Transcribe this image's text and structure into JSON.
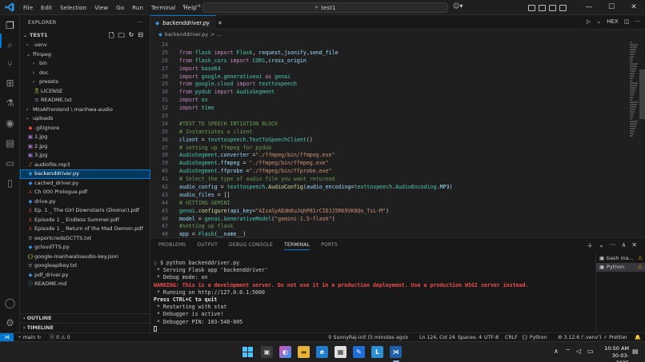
{
  "menu": [
    "File",
    "Edit",
    "Selection",
    "View",
    "Go",
    "Run",
    "Terminal",
    "Help"
  ],
  "search": {
    "text": "test1"
  },
  "sidebar": {
    "header": "EXPLORER",
    "folder": "TEST1",
    "items": [
      {
        "label": ".venv",
        "depth": 1,
        "type": "folder",
        "open": false,
        "color": "#cccccc"
      },
      {
        "label": "ffmpeg",
        "depth": 1,
        "type": "folder",
        "open": true,
        "color": "#cccccc"
      },
      {
        "label": "bin",
        "depth": 2,
        "type": "folder",
        "open": false,
        "color": "#cccccc"
      },
      {
        "label": "doc",
        "depth": 2,
        "type": "folder",
        "open": false,
        "color": "#cccccc"
      },
      {
        "label": "presets",
        "depth": 2,
        "type": "folder",
        "open": false,
        "color": "#cccccc"
      },
      {
        "label": "LICENSE",
        "depth": 2,
        "type": "license",
        "color": "#cccccc"
      },
      {
        "label": "README.txt",
        "depth": 2,
        "type": "txt",
        "color": "#cccccc"
      },
      {
        "label": "MtoAFrontend \\ manhwa-audio",
        "depth": 1,
        "type": "folder",
        "open": false,
        "color": "#cccccc"
      },
      {
        "label": "uploads",
        "depth": 1,
        "type": "folder",
        "open": false,
        "color": "#cccccc"
      },
      {
        "label": ".gitignore",
        "depth": 1,
        "type": "git",
        "color": "#cccccc"
      },
      {
        "label": "1.jpg",
        "depth": 1,
        "type": "img",
        "color": "#cccccc"
      },
      {
        "label": "2.jpg",
        "depth": 1,
        "type": "img",
        "color": "#cccccc"
      },
      {
        "label": "3.jpg",
        "depth": 1,
        "type": "img",
        "color": "#cccccc"
      },
      {
        "label": "audiofile.mp3",
        "depth": 1,
        "type": "audio",
        "color": "#cccccc"
      },
      {
        "label": "backenddriver.py",
        "depth": 1,
        "type": "py",
        "color": "#ffffff",
        "selected": true
      },
      {
        "label": "cached_driver.py",
        "depth": 1,
        "type": "py",
        "color": "#cccccc"
      },
      {
        "label": "Ch 000 Prologue.pdf",
        "depth": 1,
        "type": "pdf",
        "color": "#cccccc"
      },
      {
        "label": "drive.py",
        "depth": 1,
        "type": "py",
        "color": "#cccccc"
      },
      {
        "label": "Ep. 1 _ The Girl Downstairs (Doona!).pdf",
        "depth": 1,
        "type": "pdf",
        "color": "#cccccc"
      },
      {
        "label": "Episode 1 _ Endless Summer.pdf",
        "depth": 1,
        "type": "pdf",
        "color": "#cccccc"
      },
      {
        "label": "Episode 1 _ Return of the Mad Demon.pdf",
        "depth": 1,
        "type": "pdf",
        "color": "#cccccc"
      },
      {
        "label": "exportcredsGCTTS.txt",
        "depth": 1,
        "type": "txt",
        "color": "#cccccc"
      },
      {
        "label": "gcloudTTS.py",
        "depth": 1,
        "type": "py",
        "color": "#cccccc"
      },
      {
        "label": "google-manhwatoaudio-key.json",
        "depth": 1,
        "type": "json",
        "color": "#cccccc"
      },
      {
        "label": "googleapikey.txt",
        "depth": 1,
        "type": "txt",
        "color": "#cccccc"
      },
      {
        "label": "pdf_driver.py",
        "depth": 1,
        "type": "py",
        "color": "#cccccc"
      },
      {
        "label": "README.md",
        "depth": 1,
        "type": "md",
        "color": "#cccccc"
      }
    ],
    "outline": "OUTLINE",
    "timeline": "TIMELINE"
  },
  "editor": {
    "tab": "backenddriver.py",
    "breadcrumb_file": "backenddriver.py",
    "breadcrumb_rest": "> ...",
    "lines": [
      {
        "n": "24",
        "t": []
      },
      {
        "n": "25",
        "t": [
          [
            "kw",
            "from "
          ],
          [
            "cls",
            "flask "
          ],
          [
            "kw",
            "import "
          ],
          [
            "cls",
            "Flask"
          ],
          [
            "txt",
            ", "
          ],
          [
            "id",
            "request"
          ],
          [
            "txt",
            ","
          ],
          [
            "id",
            "jsonify"
          ],
          [
            "txt",
            ","
          ],
          [
            "id",
            "send_file"
          ]
        ]
      },
      {
        "n": "26",
        "t": [
          [
            "kw",
            "from "
          ],
          [
            "cls",
            "flask_cors "
          ],
          [
            "kw",
            "import "
          ],
          [
            "cls",
            "CORS"
          ],
          [
            "txt",
            ","
          ],
          [
            "id",
            "cross_origin"
          ]
        ]
      },
      {
        "n": "27",
        "t": [
          [
            "kw",
            "import "
          ],
          [
            "cls",
            "base64"
          ]
        ]
      },
      {
        "n": "28",
        "t": [
          [
            "kw",
            "import "
          ],
          [
            "cls",
            "google.generativeai "
          ],
          [
            "kw",
            "as "
          ],
          [
            "cls",
            "genai"
          ]
        ]
      },
      {
        "n": "29",
        "t": [
          [
            "kw",
            "from "
          ],
          [
            "cls",
            "google.cloud "
          ],
          [
            "kw",
            "import "
          ],
          [
            "cls",
            "texttospeech"
          ]
        ]
      },
      {
        "n": "30",
        "t": [
          [
            "kw",
            "from "
          ],
          [
            "cls",
            "pydub "
          ],
          [
            "kw",
            "import "
          ],
          [
            "cls",
            "AudioSegment"
          ]
        ]
      },
      {
        "n": "31",
        "t": [
          [
            "kw",
            "import "
          ],
          [
            "cls",
            "os"
          ]
        ]
      },
      {
        "n": "32",
        "t": [
          [
            "kw",
            "import "
          ],
          [
            "cls",
            "time"
          ]
        ]
      },
      {
        "n": "33",
        "t": []
      },
      {
        "n": "34",
        "t": [
          [
            "cmt",
            "#TEXT TO SPEECH INTIATION BLOCK"
          ]
        ]
      },
      {
        "n": "35",
        "t": [
          [
            "cmt",
            "# Instantiates a client"
          ]
        ]
      },
      {
        "n": "36",
        "t": [
          [
            "id",
            "client "
          ],
          [
            "txt",
            "= "
          ],
          [
            "cls",
            "texttospeech"
          ],
          [
            "txt",
            "."
          ],
          [
            "cls",
            "TextToSpeechClient"
          ],
          [
            "txt",
            "()"
          ]
        ]
      },
      {
        "n": "37",
        "t": [
          [
            "cmt",
            "# setting up ffmpeg for pydub"
          ]
        ]
      },
      {
        "n": "38",
        "t": [
          [
            "cls",
            "AudioSegment"
          ],
          [
            "txt",
            "."
          ],
          [
            "id",
            "converter "
          ],
          [
            "txt",
            "="
          ],
          [
            "str",
            "\"./ffmpeg/bin/ffmpeg.exe\""
          ]
        ]
      },
      {
        "n": "39",
        "t": [
          [
            "cls",
            "AudioSegment"
          ],
          [
            "txt",
            "."
          ],
          [
            "id",
            "ffmpeg "
          ],
          [
            "txt",
            "= "
          ],
          [
            "str",
            "\"./ffmpeg/bin/ffmpeg.exe\""
          ]
        ]
      },
      {
        "n": "40",
        "t": [
          [
            "cls",
            "AudioSegment"
          ],
          [
            "txt",
            "."
          ],
          [
            "id",
            "ffprobe "
          ],
          [
            "txt",
            "="
          ],
          [
            "str",
            "\"./ffmpeg/bin/ffprobe.exe\""
          ]
        ]
      },
      {
        "n": "41",
        "t": [
          [
            "cmt",
            "# Select the type of audio file you want returned"
          ]
        ]
      },
      {
        "n": "42",
        "t": [
          [
            "id",
            "audio_config "
          ],
          [
            "txt",
            "= "
          ],
          [
            "cls",
            "texttospeech"
          ],
          [
            "txt",
            "."
          ],
          [
            "fn",
            "AudioConfig"
          ],
          [
            "txt",
            "("
          ],
          [
            "id",
            "audio_encoding"
          ],
          [
            "txt",
            "="
          ],
          [
            "cls",
            "texttospeech"
          ],
          [
            "txt",
            "."
          ],
          [
            "cls",
            "AudioEncoding"
          ],
          [
            "txt",
            "."
          ],
          [
            "id",
            "MP3"
          ],
          [
            "txt",
            ")"
          ]
        ]
      },
      {
        "n": "43",
        "t": [
          [
            "id",
            "audio_files "
          ],
          [
            "txt",
            "= []"
          ]
        ]
      },
      {
        "n": "44",
        "t": [
          [
            "cmt",
            "# HITTING GEMINI"
          ]
        ]
      },
      {
        "n": "45",
        "t": [
          [
            "cls",
            "genai"
          ],
          [
            "txt",
            "."
          ],
          [
            "fn",
            "configure"
          ],
          [
            "txt",
            "("
          ],
          [
            "id",
            "api_key"
          ],
          [
            "txt",
            "="
          ],
          [
            "str",
            "\"AIzaSyAEdm6uJqhP81rCIDJJ5RK9VK8Qo_TsL-M\""
          ],
          [
            "txt",
            ")"
          ]
        ]
      },
      {
        "n": "46",
        "t": [
          [
            "id",
            "model "
          ],
          [
            "txt",
            "= "
          ],
          [
            "cls",
            "genai"
          ],
          [
            "txt",
            "."
          ],
          [
            "cls",
            "GenerativeModel"
          ],
          [
            "txt",
            "("
          ],
          [
            "str",
            "\"gemini-1.5-flash\""
          ],
          [
            "txt",
            ")"
          ]
        ]
      },
      {
        "n": "47",
        "t": [
          [
            "cmt",
            "#setting up flask"
          ]
        ]
      },
      {
        "n": "48",
        "t": [
          [
            "id",
            "app "
          ],
          [
            "txt",
            "= "
          ],
          [
            "cls",
            "Flask"
          ],
          [
            "txt",
            "("
          ],
          [
            "id",
            "__name__"
          ],
          [
            "txt",
            ")"
          ]
        ]
      }
    ]
  },
  "panel": {
    "tabs": [
      "PROBLEMS",
      "OUTPUT",
      "DEBUG CONSOLE",
      "TERMINAL",
      "PORTS"
    ],
    "active_tab": "TERMINAL",
    "terminal": [
      {
        "text": "$ python backenddriver.py",
        "style": "normal"
      },
      {
        "text": " * Serving Flask app 'backenddriver'",
        "style": "normal"
      },
      {
        "text": " * Debug mode: on",
        "style": "normal"
      },
      {
        "text": "WARNING: This is a development server. Do not use it in a production deployment. Use a production WSGI server instead.",
        "style": "warn"
      },
      {
        "text": " * Running on http://127.0.0.1:5000",
        "style": "normal"
      },
      {
        "text": "Press CTRL+C to quit",
        "style": "bold"
      },
      {
        "text": " * Restarting with stat",
        "style": "normal"
      },
      {
        "text": " * Debugger is active!",
        "style": "normal"
      },
      {
        "text": " * Debugger PIN: 103-548-005",
        "style": "normal"
      }
    ],
    "terminals": [
      "bash ma...",
      "Python"
    ]
  },
  "status": {
    "branch": "main",
    "errors": "0",
    "warnings": "0",
    "blame": "SunnyRaj-init (5 minutes ago)",
    "position": "Ln 124, Col 24",
    "spaces": "Spaces: 4",
    "encoding": "UTF-8",
    "eol": "CRLF",
    "language": "Python",
    "interpreter": "3.12.6 ('.venv')",
    "prettier": "Prettier"
  },
  "taskbar": {
    "time": "10:50 AM",
    "date": "30-03-2025"
  },
  "colors": {
    "accent": "#0078d4",
    "selection": "#04395e"
  }
}
